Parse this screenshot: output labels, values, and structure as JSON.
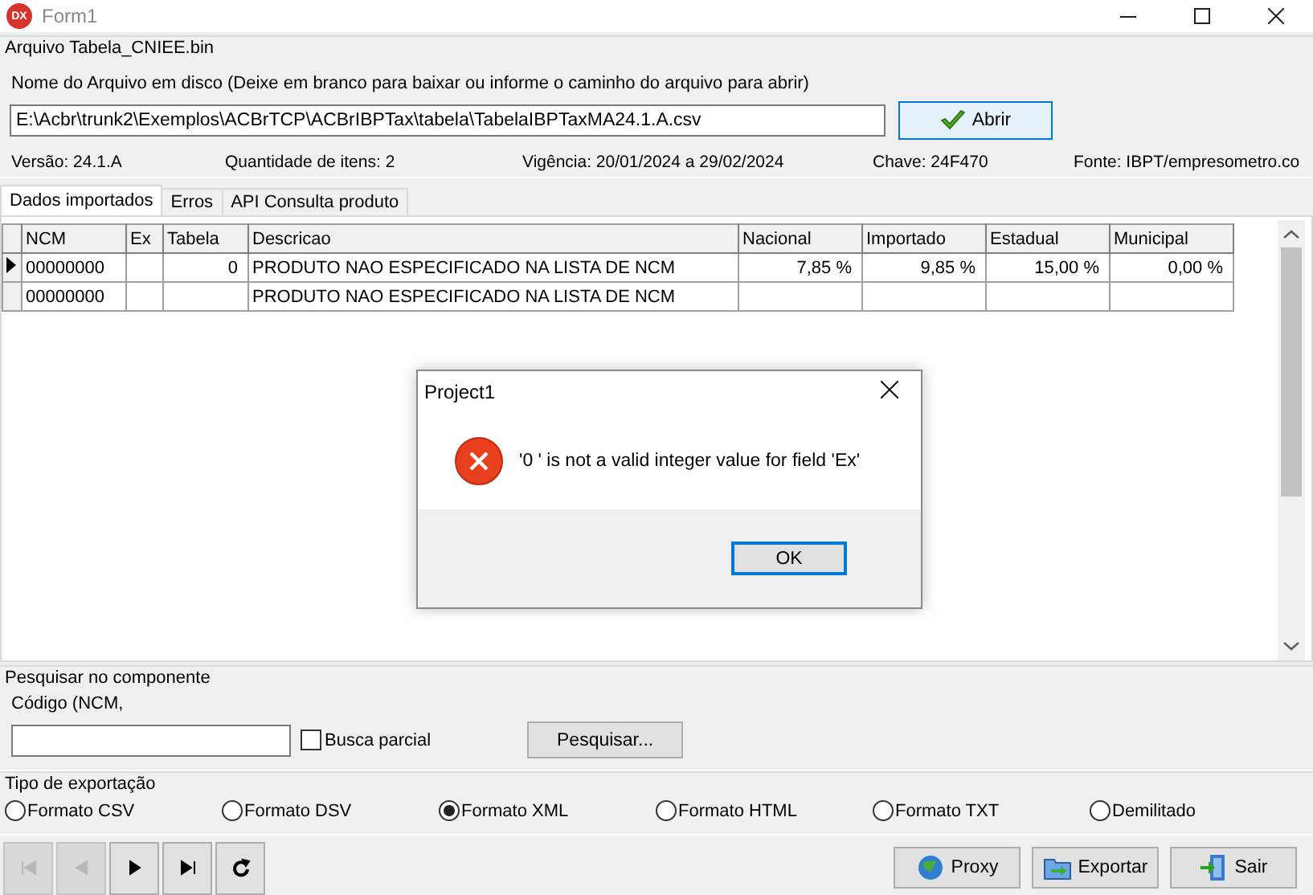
{
  "window": {
    "title": "Form1",
    "app_icon_text": "DX"
  },
  "file_group": {
    "title": "Arquivo Tabela_CNIEE.bin",
    "field_label": "Nome do Arquivo em disco (Deixe em branco para baixar ou informe o caminho do arquivo para abrir)",
    "path": "E:\\Acbr\\trunk2\\Exemplos\\ACBrTCP\\ACBrIBPTax\\tabela\\TabelaIBPTaxMA24.1.A.csv",
    "open_button": "Abrir",
    "info": [
      "Versão: 24.1.A",
      "Quantidade de itens: 2",
      "Vigência: 20/01/2024 a 29/02/2024",
      "Chave: 24F470",
      "Fonte: IBPT/empresometro.co"
    ]
  },
  "tabs": [
    {
      "label": "Dados importados",
      "selected": true
    },
    {
      "label": "Erros",
      "selected": false
    },
    {
      "label": "API Consulta produto",
      "selected": false
    }
  ],
  "table": {
    "columns": [
      {
        "label": "NCM",
        "numeric": false
      },
      {
        "label": "Ex"
      },
      {
        "label": "Tabela",
        "numeric": true
      },
      {
        "label": "Descricao",
        "numeric": false
      },
      {
        "label": "Nacional",
        "numeric": true
      },
      {
        "label": "Importado",
        "numeric": true
      },
      {
        "label": "Estadual",
        "numeric": true
      },
      {
        "label": "Municipal",
        "numeric": true
      }
    ],
    "rows": [
      {
        "selected": true,
        "cells": [
          "00000000",
          "",
          "0",
          "PRODUTO NAO ESPECIFICADO NA LISTA DE NCM",
          "7,85 %",
          "9,85 %",
          "15,00 %",
          "0,00 %"
        ]
      },
      {
        "selected": false,
        "cells": [
          "00000000",
          "",
          "",
          "PRODUTO NAO ESPECIFICADO NA LISTA DE NCM",
          "",
          "",
          "",
          ""
        ]
      }
    ]
  },
  "search_group": {
    "title": "Pesquisar no componente",
    "field_label": "Código (NCM,",
    "checkbox": {
      "label": "Busca parcial",
      "checked": false
    },
    "button": "Pesquisar..."
  },
  "export_group": {
    "title": "Tipo de exportação",
    "options": [
      {
        "label": "Formato CSV",
        "selected": false
      },
      {
        "label": "Formato DSV",
        "selected": false
      },
      {
        "label": "Formato XML",
        "selected": true
      },
      {
        "label": "Formato HTML",
        "selected": false
      },
      {
        "label": "Formato TXT",
        "selected": false
      },
      {
        "label": "Demilitado",
        "selected": false
      }
    ]
  },
  "navigator": [
    {
      "kind": "first",
      "disabled": true
    },
    {
      "kind": "prior",
      "disabled": true
    },
    {
      "kind": "next",
      "disabled": false
    },
    {
      "kind": "last",
      "disabled": false
    },
    {
      "kind": "refresh",
      "disabled": false
    }
  ],
  "actions": [
    {
      "kind": "proxy",
      "label": "Proxy"
    },
    {
      "kind": "export",
      "label": "Exportar"
    },
    {
      "kind": "exit",
      "label": "Sair"
    }
  ],
  "dialog": {
    "title": "Project1",
    "message": "'0 ' is not a valid integer value for field 'Ex'",
    "button": "OK"
  }
}
